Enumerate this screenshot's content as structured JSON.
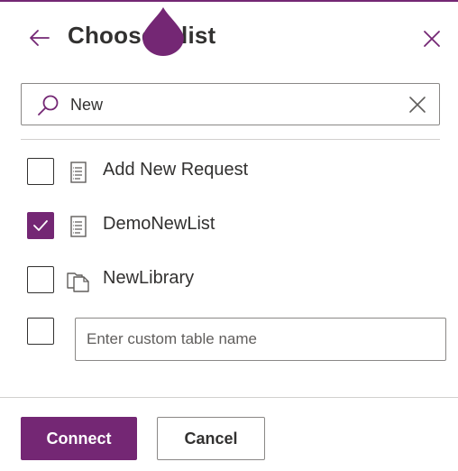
{
  "dialog": {
    "title": "Choose a list",
    "back_icon": "arrow-left-icon",
    "close_icon": "close-icon"
  },
  "search": {
    "value": "New",
    "icon": "search-icon",
    "clear_icon": "clear-icon"
  },
  "list": {
    "items": [
      {
        "label": "Add New Request",
        "checked": false,
        "icon": "list-icon"
      },
      {
        "label": "DemoNewList",
        "checked": true,
        "icon": "list-icon"
      },
      {
        "label": "NewLibrary",
        "checked": false,
        "icon": "library-icon"
      }
    ],
    "custom": {
      "checked": false,
      "placeholder": "Enter custom table name"
    }
  },
  "buttons": {
    "connect": "Connect",
    "cancel": "Cancel"
  },
  "colors": {
    "accent": "#742774"
  }
}
